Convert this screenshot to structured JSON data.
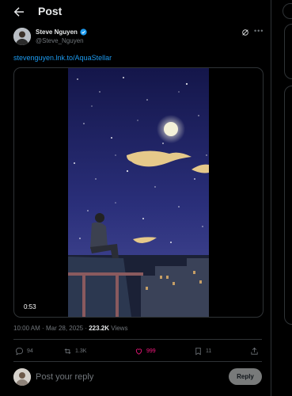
{
  "header": {
    "title": "Post",
    "back_icon": "arrow-left-icon"
  },
  "author": {
    "name": "Steve Nguyen",
    "handle": "@Steve_Nguyen",
    "verified_color": "#1d9bf0"
  },
  "tweet": {
    "link_text": "stevenguyen.lnk.to/AquaStellar"
  },
  "media": {
    "duration": "0:53",
    "scene": {
      "sky_colors": [
        "#14164a",
        "#2a2f7a",
        "#4a4e9a"
      ],
      "moon_color": "#f4f1d8",
      "whale_color": "#e6c98a",
      "rooftop_color": "#2c3850",
      "railing_color": "#8a5a5e"
    }
  },
  "meta": {
    "time": "10:00 AM",
    "date": "Mar 28, 2025",
    "separator": "·",
    "views_count": "223.2K",
    "views_label": "Views"
  },
  "actions": {
    "replies": "94",
    "reposts": "1.3K",
    "likes": "999",
    "bookmarks": "11",
    "liked_color": "#f91880"
  },
  "reply": {
    "placeholder": "Post your reply",
    "button_label": "Reply"
  }
}
